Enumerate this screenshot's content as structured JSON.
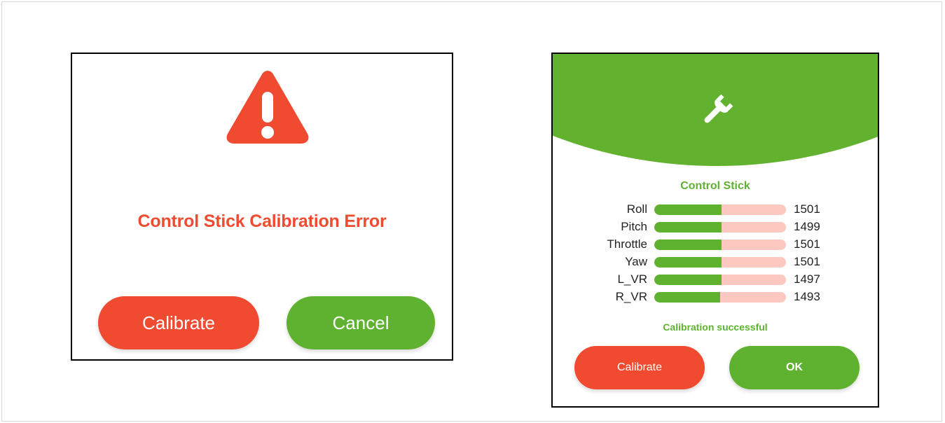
{
  "error_dialog": {
    "icon": "warning-triangle-icon",
    "title": "Control Stick Calibration Error",
    "calibrate_label": "Calibrate",
    "cancel_label": "Cancel"
  },
  "success_dialog": {
    "icon": "wrench-icon",
    "section_title": "Control Stick",
    "channels": [
      {
        "label": "Roll",
        "value": "1501",
        "fill": 0.51
      },
      {
        "label": "Pitch",
        "value": "1499",
        "fill": 0.51
      },
      {
        "label": "Throttle",
        "value": "1501",
        "fill": 0.51
      },
      {
        "label": "Yaw",
        "value": "1501",
        "fill": 0.51
      },
      {
        "label": "L_VR",
        "value": "1497",
        "fill": 0.51
      },
      {
        "label": "R_VR",
        "value": "1493",
        "fill": 0.5
      }
    ],
    "status": "Calibration successful",
    "calibrate_label": "Calibrate",
    "ok_label": "OK"
  },
  "colors": {
    "error_red": "#f04a30",
    "success_green": "#5fb230",
    "bar_track": "#fdc8c0"
  }
}
